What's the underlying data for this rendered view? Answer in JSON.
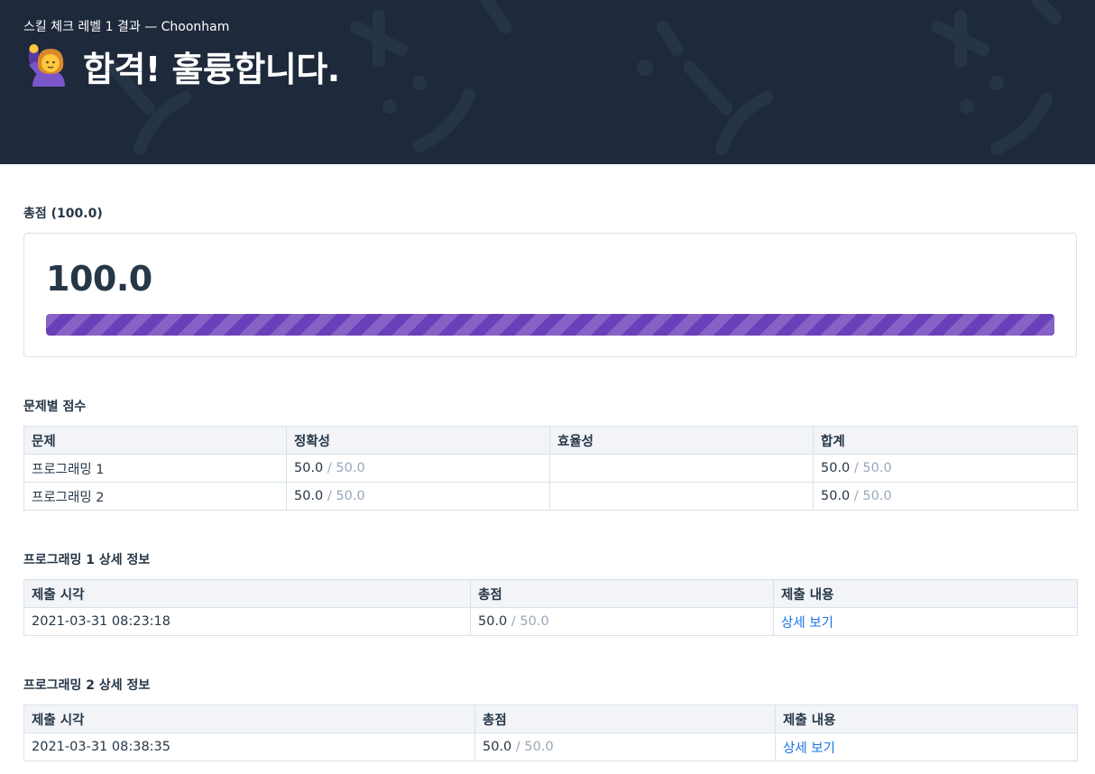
{
  "header": {
    "subtitle": "스킬 체크 레벨 1 결과 — Choonham",
    "title": "합격! 훌륭합니다.",
    "emoji_icon": "person-raising-hand-icon"
  },
  "total": {
    "section_title": "총점 (100.0)",
    "score": "100.0",
    "progress_percent": 100,
    "bar_color": "#6b3fba"
  },
  "problems": {
    "section_title": "문제별 점수",
    "headers": [
      "문제",
      "정확성",
      "효율성",
      "합계"
    ],
    "rows": [
      {
        "name": "프로그래밍 1",
        "accuracy": "50.0",
        "accuracy_max": " / 50.0",
        "efficiency": "",
        "sum": "50.0",
        "sum_max": " / 50.0"
      },
      {
        "name": "프로그래밍 2",
        "accuracy": "50.0",
        "accuracy_max": " / 50.0",
        "efficiency": "",
        "sum": "50.0",
        "sum_max": " / 50.0"
      }
    ]
  },
  "detail1": {
    "section_title": "프로그래밍 1 상세 정보",
    "headers": [
      "제출 시각",
      "총점",
      "제출 내용"
    ],
    "row": {
      "time": "2021-03-31 08:23:18",
      "score": "50.0",
      "score_max": " / 50.0",
      "link": "상세 보기"
    }
  },
  "detail2": {
    "section_title": "프로그래밍 2 상세 정보",
    "headers": [
      "제출 시각",
      "총점",
      "제출 내용"
    ],
    "row": {
      "time": "2021-03-31 08:38:35",
      "score": "50.0",
      "score_max": " / 50.0",
      "link": "상세 보기"
    }
  },
  "colors": {
    "header_bg": "#1e293b",
    "link": "#1a73e8",
    "muted": "#98a8b9"
  }
}
